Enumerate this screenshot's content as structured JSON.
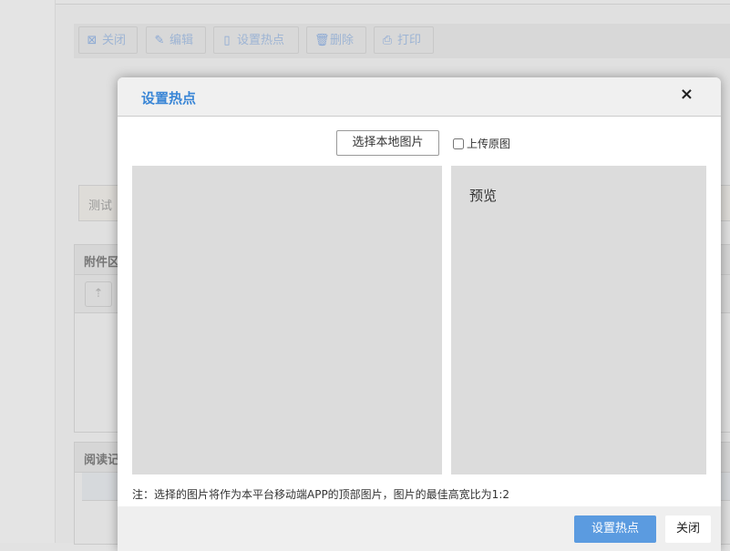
{
  "toolbar": {
    "items": [
      {
        "label": "关闭",
        "icon": "close-square-icon"
      },
      {
        "label": "编辑",
        "icon": "pencil-icon"
      },
      {
        "label": "设置热点",
        "icon": "file-fire-icon"
      },
      {
        "label": "删除",
        "icon": "trash-icon"
      },
      {
        "label": "打印",
        "icon": "printer-icon"
      }
    ]
  },
  "background": {
    "field_value": "测试",
    "attachments_title": "附件区",
    "reading_title": "阅读记"
  },
  "modal": {
    "title": "设置热点",
    "close_glyph": "×",
    "pick_button": "选择本地图片",
    "upload_original_label": "上传原图",
    "upload_original_checked": false,
    "preview_label": "预览",
    "note": "注：选择的图片将作为本平台移动端APP的顶部图片，图片的最佳高宽比为1:2",
    "confirm_button": "设置热点",
    "close_button": "关闭"
  },
  "colors": {
    "accent": "#5b9be0",
    "title": "#3a86d6"
  }
}
